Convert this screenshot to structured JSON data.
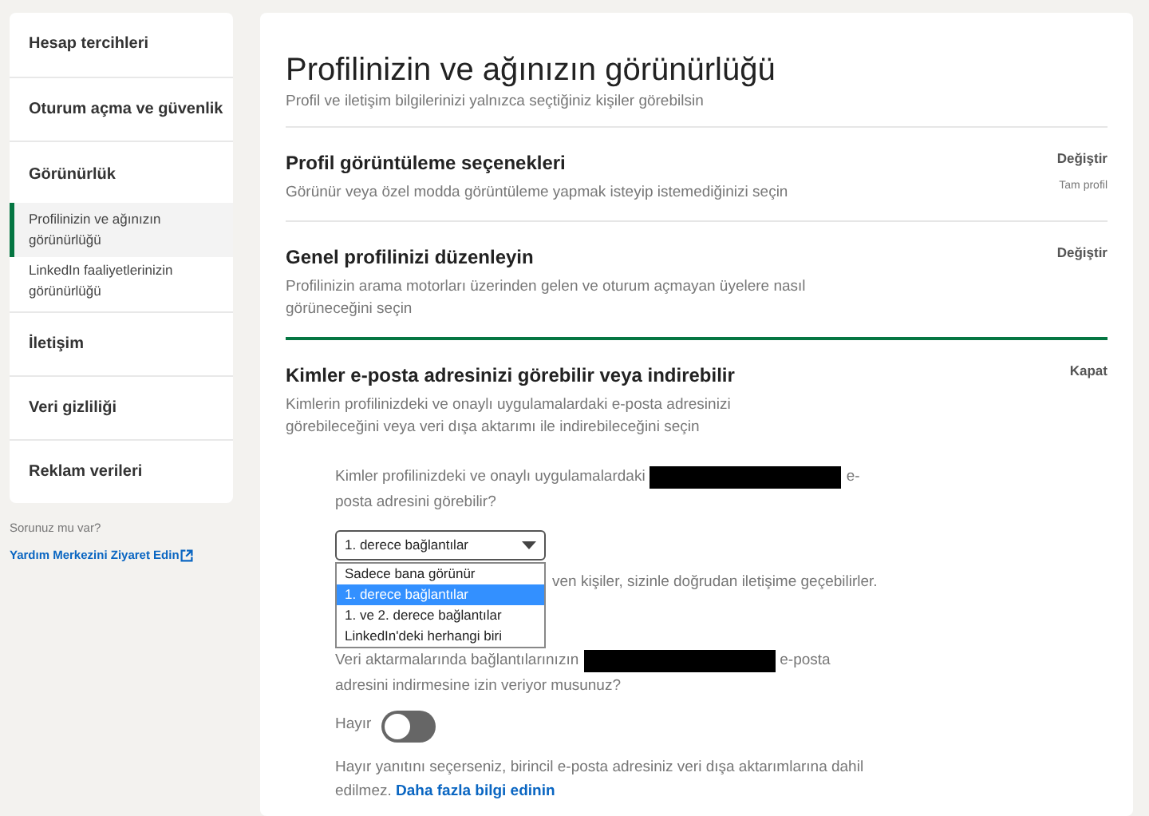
{
  "sidebar": {
    "items": [
      {
        "label": "Hesap tercihleri",
        "kind": "section",
        "selected": false
      },
      {
        "label": "Oturum açma ve güvenlik",
        "kind": "section",
        "selected": false
      },
      {
        "label": "Görünürlük",
        "kind": "heading",
        "selected": false
      },
      {
        "label": "Profilinizin ve ağınızın görünürlüğü",
        "kind": "sub",
        "selected": true
      },
      {
        "label": "LinkedIn faaliyetlerinizin görünürlüğü",
        "kind": "sub",
        "selected": false
      },
      {
        "label": "İletişim",
        "kind": "section",
        "selected": false
      },
      {
        "label": "Veri gizliliği",
        "kind": "section",
        "selected": false
      },
      {
        "label": "Reklam verileri",
        "kind": "section",
        "selected": false
      }
    ],
    "help": {
      "question": "Sorunuz mu var?",
      "link": "Yardım Merkezini Ziyaret Edin"
    }
  },
  "main": {
    "title": "Profilinizin ve ağınızın görünürlüğü",
    "subtitle": "Profil ve iletişim bilgilerinizi yalnızca seçtiğiniz kişiler görebilsin",
    "sections": [
      {
        "title": "Profil görüntüleme seçenekleri",
        "description": "Görünür veya özel modda görüntüleme yapmak isteyip istemediğinizi seçin",
        "action": "Değiştir",
        "value": "Tam profil",
        "expanded": false
      },
      {
        "title": "Genel profilinizi düzenleyin",
        "description": "Profilinizin arama motorları üzerinden gelen ve oturum açmayan üyelere nasıl görüneceğini seçin",
        "action": "Değiştir",
        "expanded": false
      },
      {
        "title": "Kimler e-posta adresinizi görebilir veya indirebilir",
        "description": "Kimlerin profilinizdeki ve onaylı uygulamalardaki e-posta adresinizi görebileceğini veya veri dışa aktarımı ile indirebileceğini seçin",
        "action": "Kapat",
        "expanded": true
      }
    ],
    "email": {
      "question": [
        [
          {
            "kind": "text",
            "text": "Kimler profilinizdeki ve onaylı uygulamalardaki"
          },
          {
            "kind": "redacted"
          },
          {
            "kind": "text",
            "text": "e-"
          }
        ],
        [
          {
            "kind": "text",
            "text": "posta adresini görebilir?"
          }
        ]
      ],
      "select": {
        "value": "1. derece bağlantılar",
        "options": [
          {
            "label": "Sadece bana görünür",
            "selected": false
          },
          {
            "label": "1. derece bağlantılar",
            "selected": true
          },
          {
            "label": "1. ve 2. derece bağlantılar",
            "selected": false
          },
          {
            "label": "LinkedIn'deki herhangi biri",
            "selected": false
          }
        ]
      },
      "hint": "ven kişiler, sizinle doğrudan iletişime geçebilirler.",
      "export_question": [
        [
          {
            "kind": "text",
            "text": "Veri aktarmalarında bağlantılarınızın"
          },
          {
            "kind": "redacted"
          },
          {
            "kind": "text",
            "text": "e-posta"
          }
        ],
        [
          {
            "kind": "text",
            "text": "adresini indirmesine izin veriyor musunuz?"
          }
        ]
      ],
      "toggle": {
        "label": "Hayır",
        "on": false
      },
      "note": {
        "text": "Hayır yanıtını seçerseniz, birincil e-posta adresiniz veri dışa aktarımlarına dahil edilmez.",
        "link": "Daha fazla bilgi edinin"
      }
    }
  }
}
